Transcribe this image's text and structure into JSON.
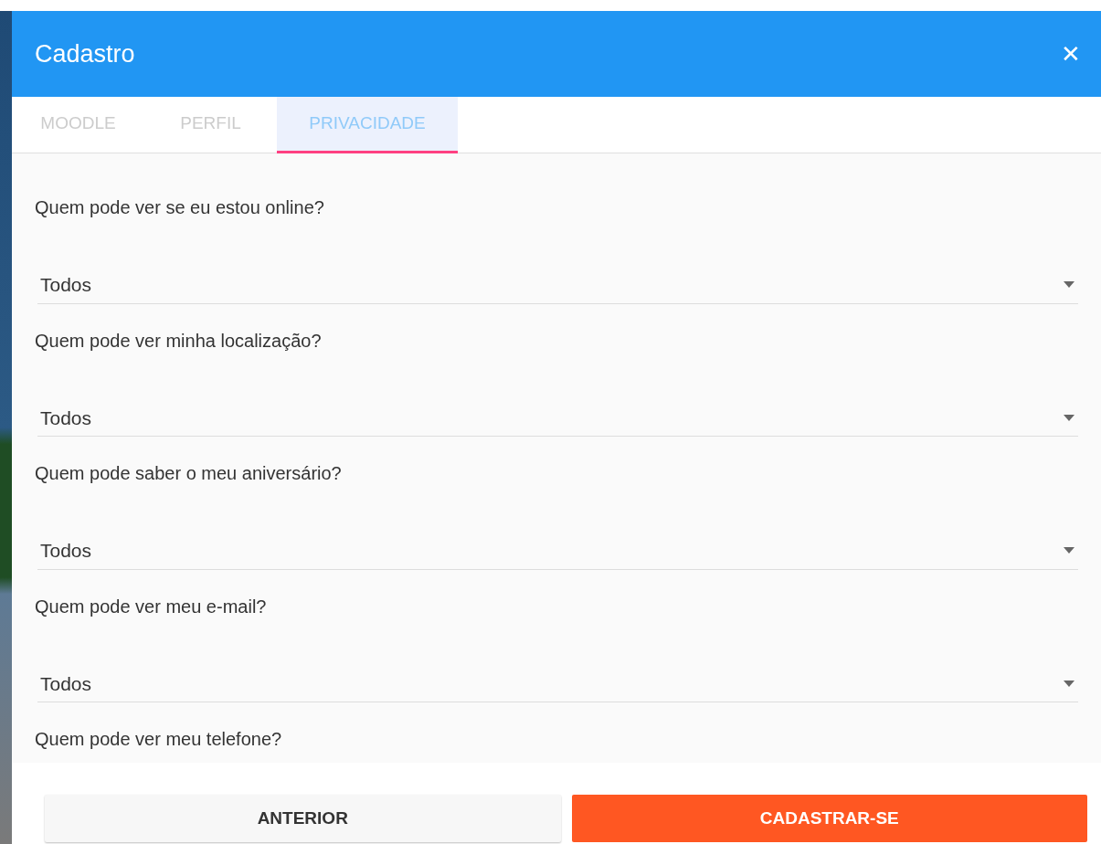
{
  "dialog": {
    "title": "Cadastro",
    "close": "✕"
  },
  "tabs": [
    {
      "label": "MOODLE",
      "selected": false
    },
    {
      "label": "PERFIL",
      "selected": false
    },
    {
      "label": "PRIVACIDADE",
      "selected": true
    }
  ],
  "questions": [
    {
      "label": "Quem pode ver se eu estou online?",
      "value": "Todos"
    },
    {
      "label": "Quem pode ver minha localização?",
      "value": "Todos"
    },
    {
      "label": "Quem pode saber o meu aniversário?",
      "value": "Todos"
    },
    {
      "label": "Quem pode ver meu e-mail?",
      "value": "Todos"
    },
    {
      "label": "Quem pode ver meu telefone?"
    }
  ],
  "buttons": [
    {
      "label": "ANTERIOR",
      "kind": "secondary"
    },
    {
      "label": "CADASTRAR-SE",
      "kind": "primary"
    }
  ]
}
